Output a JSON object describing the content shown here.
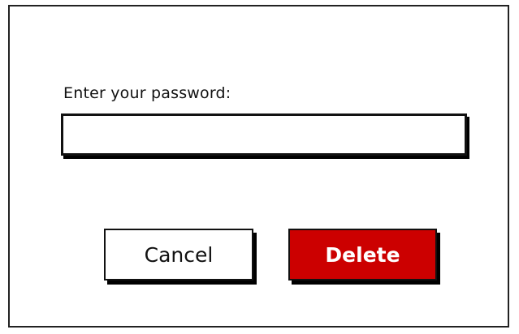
{
  "dialog": {
    "password_label": "Enter your password:",
    "password_value": "",
    "cancel_label": "Cancel",
    "delete_label": "Delete"
  },
  "colors": {
    "delete_background": "#cc0000",
    "delete_text": "#ffffff",
    "border": "#111111",
    "background": "#ffffff"
  }
}
